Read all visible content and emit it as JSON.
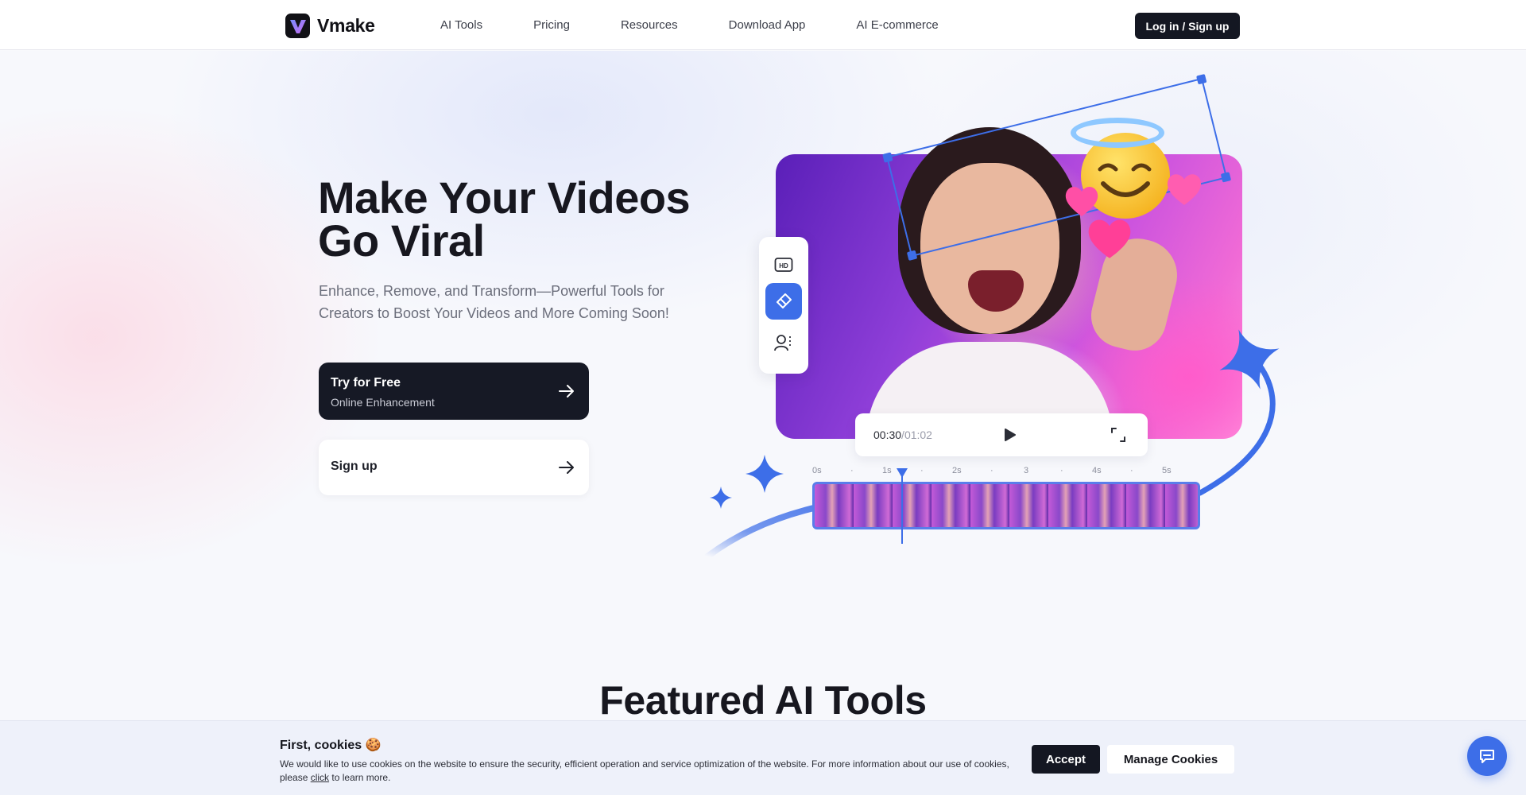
{
  "brand": {
    "name": "Vmake",
    "accent": "#3d6ee8",
    "dark": "#141722"
  },
  "nav": {
    "items": [
      "AI Tools",
      "Pricing",
      "Resources",
      "Download App",
      "AI E-commerce"
    ],
    "login_label": "Log in / Sign up"
  },
  "hero": {
    "title": "Make Your Videos Go Viral",
    "subtitle": "Enhance, Remove, and Transform—Powerful Tools for Creators to Boost Your Videos and More Coming Soon!",
    "cta_primary": {
      "label": "Try for Free",
      "sublabel": "Online Enhancement"
    },
    "cta_secondary": {
      "label": "Sign up"
    }
  },
  "showcase": {
    "tools": [
      {
        "icon": "hd-icon"
      },
      {
        "icon": "eraser-icon",
        "active": true
      },
      {
        "icon": "portrait-icon"
      }
    ],
    "player": {
      "current": "00:30",
      "separator": "/",
      "duration": "01:02"
    },
    "timeline_ticks": [
      "0s",
      "·",
      "1s",
      "·",
      "2s",
      "·",
      "3",
      "·",
      "4s",
      "·",
      "5s"
    ]
  },
  "featured": {
    "title": "Featured AI Tools"
  },
  "cookie": {
    "title": "First, cookies 🍪",
    "text_before": "We would like to use cookies on the website to ensure the security, efficient operation and service optimization of the website. For more information about our use of cookies, please ",
    "link_text": "click",
    "text_after": " to learn more.",
    "accept_label": "Accept",
    "manage_label": "Manage Cookies"
  },
  "chat": {
    "icon": "chat-icon"
  }
}
